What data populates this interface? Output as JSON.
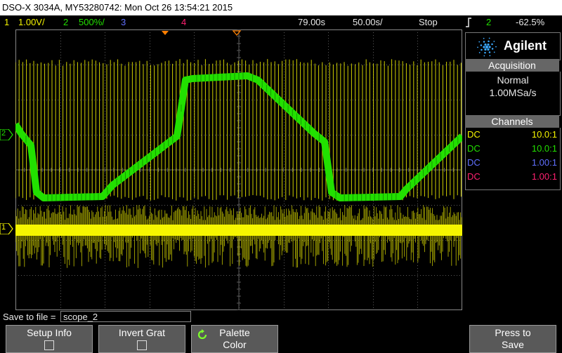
{
  "title": "DSO-X 3034A, MY53280742: Mon Oct 26 13:54:21 2015",
  "status": {
    "ch1_num": "1",
    "ch1_scale": "1.00V/",
    "ch2_num": "2",
    "ch2_scale": "500%/",
    "ch3_num": "3",
    "ch4_num": "4",
    "time_pos": "79.00s",
    "time_scale": "50.00s/",
    "run_state": "Stop",
    "trigger_icon": "trigger-edge-icon",
    "trigger_source": "2",
    "trigger_level": "-62.5%"
  },
  "brand": "Agilent",
  "acquisition": {
    "header": "Acquisition",
    "mode": "Normal",
    "rate": "1.00MSa/s"
  },
  "channels": {
    "header": "Channels",
    "rows": [
      {
        "coupling": "DC",
        "ratio": "10.0:1",
        "color": "#f5f500"
      },
      {
        "coupling": "DC",
        "ratio": "10.0:1",
        "color": "#22e000"
      },
      {
        "coupling": "DC",
        "ratio": "1.00:1",
        "color": "#6070ff"
      },
      {
        "coupling": "DC",
        "ratio": "1.00:1",
        "color": "#ff2070"
      }
    ]
  },
  "markers": {
    "ch2": "2",
    "ch1": "1"
  },
  "save": {
    "label": "Save to file =",
    "value": "scope_2"
  },
  "softkeys": {
    "setup_info": "Setup Info",
    "invert_grat": "Invert Grat",
    "palette_line1": "Palette",
    "palette_line2": "Color",
    "press_to": "Press to",
    "save": "Save"
  },
  "colors": {
    "ch1": "#f5f500",
    "ch2": "#22e000",
    "ch3": "#6070ff",
    "ch4": "#ff2070",
    "grid": "#5a5a5a",
    "softkey": "#595959"
  }
}
